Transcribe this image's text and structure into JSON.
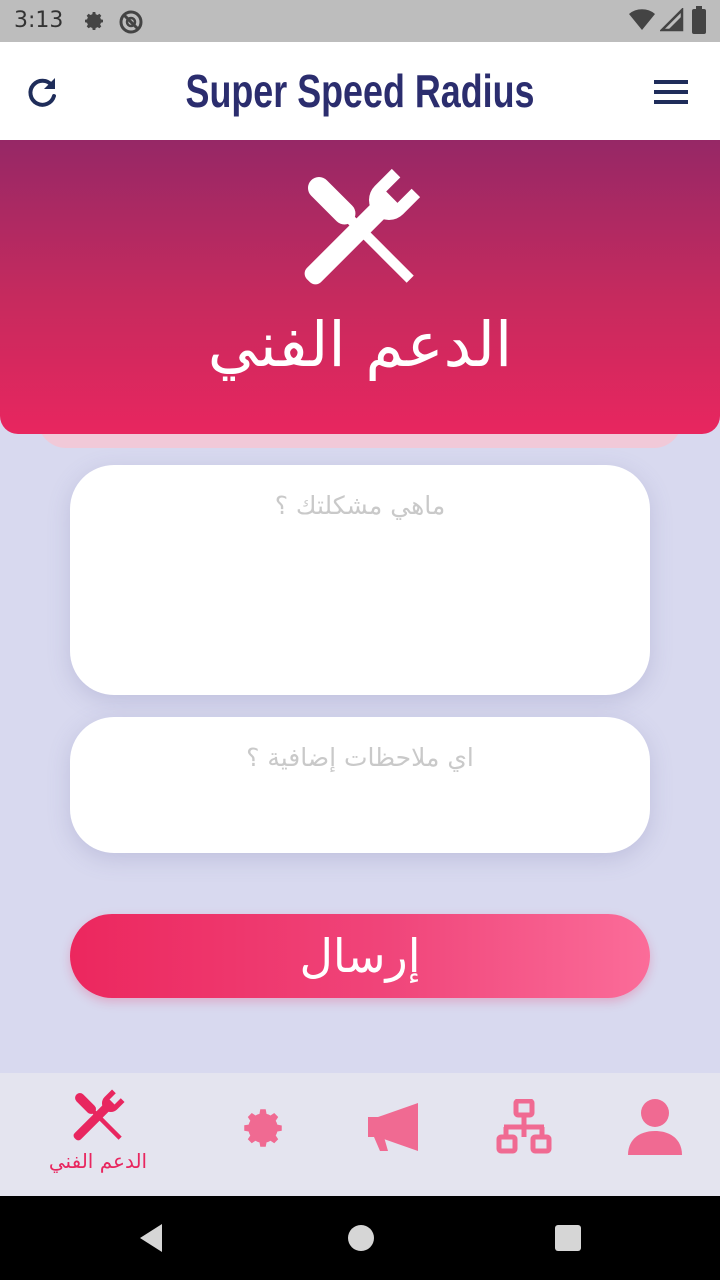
{
  "status_bar": {
    "time": "3:13",
    "icons": [
      "gear-icon",
      "do-not-disturb-icon",
      "wifi-icon",
      "signal-icon",
      "battery-icon"
    ]
  },
  "app_bar": {
    "title": "Super Speed Radius",
    "left_icon": "refresh-icon",
    "right_icon": "menu-icon"
  },
  "banner": {
    "icon": "tools-icon",
    "title": "الدعم الفني",
    "gradient": [
      "#962866",
      "#e8265f"
    ]
  },
  "form": {
    "problem_placeholder": "ماهي مشكلتك ؟",
    "problem_value": "",
    "notes_placeholder": "اي ملاحظات إضافية ؟",
    "notes_value": "",
    "submit_label": "إرسال"
  },
  "bottom_nav": {
    "items": [
      {
        "label": "الدعم الفني",
        "icon": "tools-icon",
        "active": true
      },
      {
        "label": "",
        "icon": "gear-icon",
        "active": false
      },
      {
        "label": "",
        "icon": "megaphone-icon",
        "active": false
      },
      {
        "label": "",
        "icon": "network-icon",
        "active": false
      },
      {
        "label": "",
        "icon": "user-icon",
        "active": false
      }
    ]
  },
  "colors": {
    "accent": "#e8265f",
    "nav_icon": "#f06a92",
    "title": "#2b2d6e",
    "background": "#d8d9ef"
  }
}
